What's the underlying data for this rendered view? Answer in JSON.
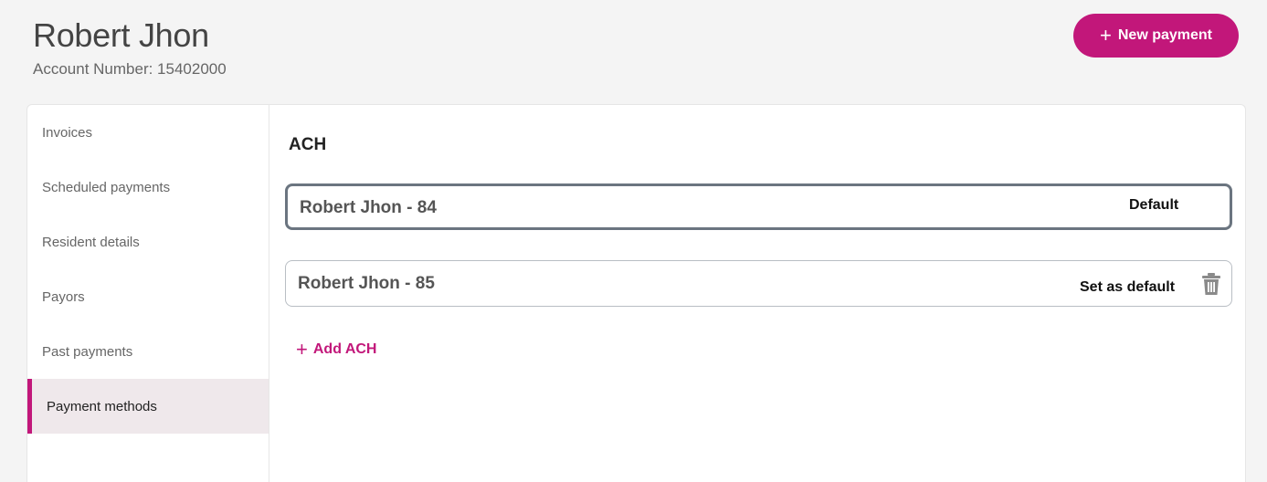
{
  "header": {
    "name": "Robert Jhon",
    "account_number": "Account Number: 15402000",
    "new_payment_label": "New payment",
    "new_payment_icon": "plus-icon"
  },
  "sidebar": {
    "items": [
      {
        "label": "Invoices",
        "active": false
      },
      {
        "label": "Scheduled payments",
        "active": false
      },
      {
        "label": "Resident details",
        "active": false
      },
      {
        "label": "Payors",
        "active": false
      },
      {
        "label": "Past payments",
        "active": false
      },
      {
        "label": "Payment methods",
        "active": true
      }
    ]
  },
  "main": {
    "section_title": "ACH",
    "methods": [
      {
        "name": "Robert Jhon - 84",
        "status": "Default"
      },
      {
        "name": "Robert Jhon - 85",
        "action": "Set as default",
        "delete_icon": "trash-icon"
      }
    ],
    "add_label": "Add ACH"
  },
  "colors": {
    "accent": "#c2177a",
    "active_sidebar_bg": "#efe8eb",
    "default_border": "#6b7580"
  }
}
